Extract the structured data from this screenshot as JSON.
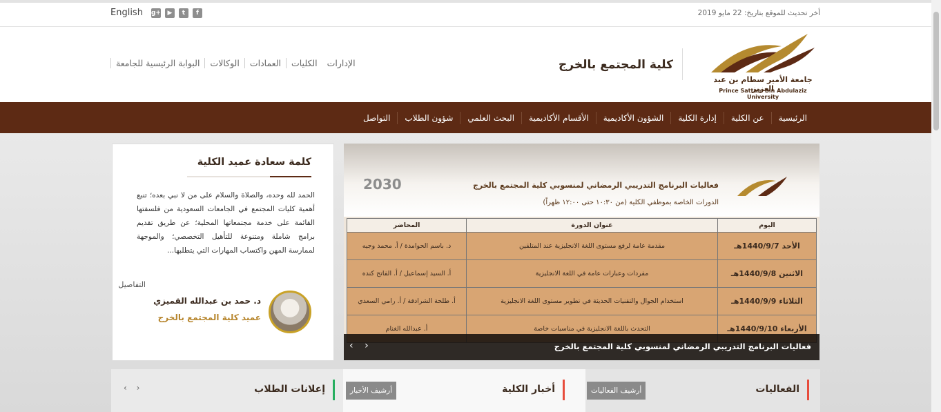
{
  "topbar": {
    "last_update": "أخر تحديث للموقع بتاريخ: 22 مايو 2019",
    "language_link": "English",
    "social_icons": [
      "googleplus-icon",
      "youtube-icon",
      "twitter-icon",
      "facebook-icon"
    ]
  },
  "header": {
    "college_name": "كلية المجتمع بالخرج",
    "logo_text_ar": "جامعة الأمير سطام بن عبد العزيز",
    "logo_text_en": "Prince Sattam Bin Abdulaziz University",
    "links": [
      "البوابة الرئيسية للجامعة",
      "الوكالات",
      "العمادات",
      "الكليات",
      "الإدارات"
    ]
  },
  "nav": {
    "items": [
      "الرئيسية",
      "عن الكلية",
      "إدارة الكلية",
      "الشؤون الأكاديمية",
      "الأقسام الأكاديمية",
      "البحث العلمي",
      "شؤون الطلاب",
      "التواصل"
    ]
  },
  "dean": {
    "title": "كلمة سعادة عميد الكلية",
    "text": "الحمد لله وحده، والصلاة والسلام على من لا نبي بعده؛ تنبع أهمية كليات المجتمع في الجامعات السعودية من فلسفتها القائمة على خدمة مجتمعاتها المحلية؛ عن طريق تقديم برامج شاملة ومتنوعة للتأهيل التخصصي؛ والموجهة لممارسة المهن واكتساب المهارات التي يتطلبها...",
    "details_link": "التفاصيل",
    "name": "د. حمد بن عبدالله القميزي",
    "role": "عميد كلية المجتمع بالخرج"
  },
  "slider": {
    "slide_title": "فعاليات البرنامج التدريبي الرمضاني لمنسوبي كلية المجتمع بالخرج",
    "slide_subtitle": "الدورات الخاصة بموظفي الكلية (من ١٠:٣٠ حتى ١٢:٠٠ ظهراً)",
    "vision_text": "2030",
    "table_headers": [
      "اليوم",
      "عنوان الدورة",
      "المحاضر"
    ],
    "table_rows": [
      [
        "الأحد 1440/9/7هـ",
        "مقدمة عامة لرفع مستوى اللغة الانجليزية عند المتلقين",
        "د. باسم الحوامدة / أ. محمد وجيه"
      ],
      [
        "الاثنين 1440/9/8هـ",
        "مفردات وعبارات عامة في اللغة الانجليزية",
        "أ. السيد إسماعيل / أ. الفاتح كنده"
      ],
      [
        "الثلاثاء 1440/9/9هـ",
        "استخدام الجوال والتقنيات الحديثة في تطوير مستوى اللغة الانجليزية",
        "أ. طلحة الشرادقة / أ. رامي السعدي"
      ],
      [
        "الأربعاء 1440/9/10هـ",
        "التحدث باللغة الانجليزية في مناسبات خاصة",
        "أ. عبدالله الغنام"
      ]
    ],
    "caption": "فعاليات البرنامج التدريبي الرمضاني لمنسوبي كلية المجتمع بالخرج",
    "prev_label": "‹",
    "next_label": "›"
  },
  "sections": {
    "events_title": "الفعاليات",
    "events_archive": "أرشيف الفعاليات",
    "news_title": "أخبار الكلية",
    "news_archive": "أرشيف الأخبار",
    "announcements_title": "إعلانات الطلاب"
  },
  "colors": {
    "nav_bg": "#5d2a14",
    "accent_gold": "#b7862e",
    "events_bar": "#e74c3c",
    "news_bar": "#e74c3c",
    "announcements_bar": "#27ae60"
  }
}
